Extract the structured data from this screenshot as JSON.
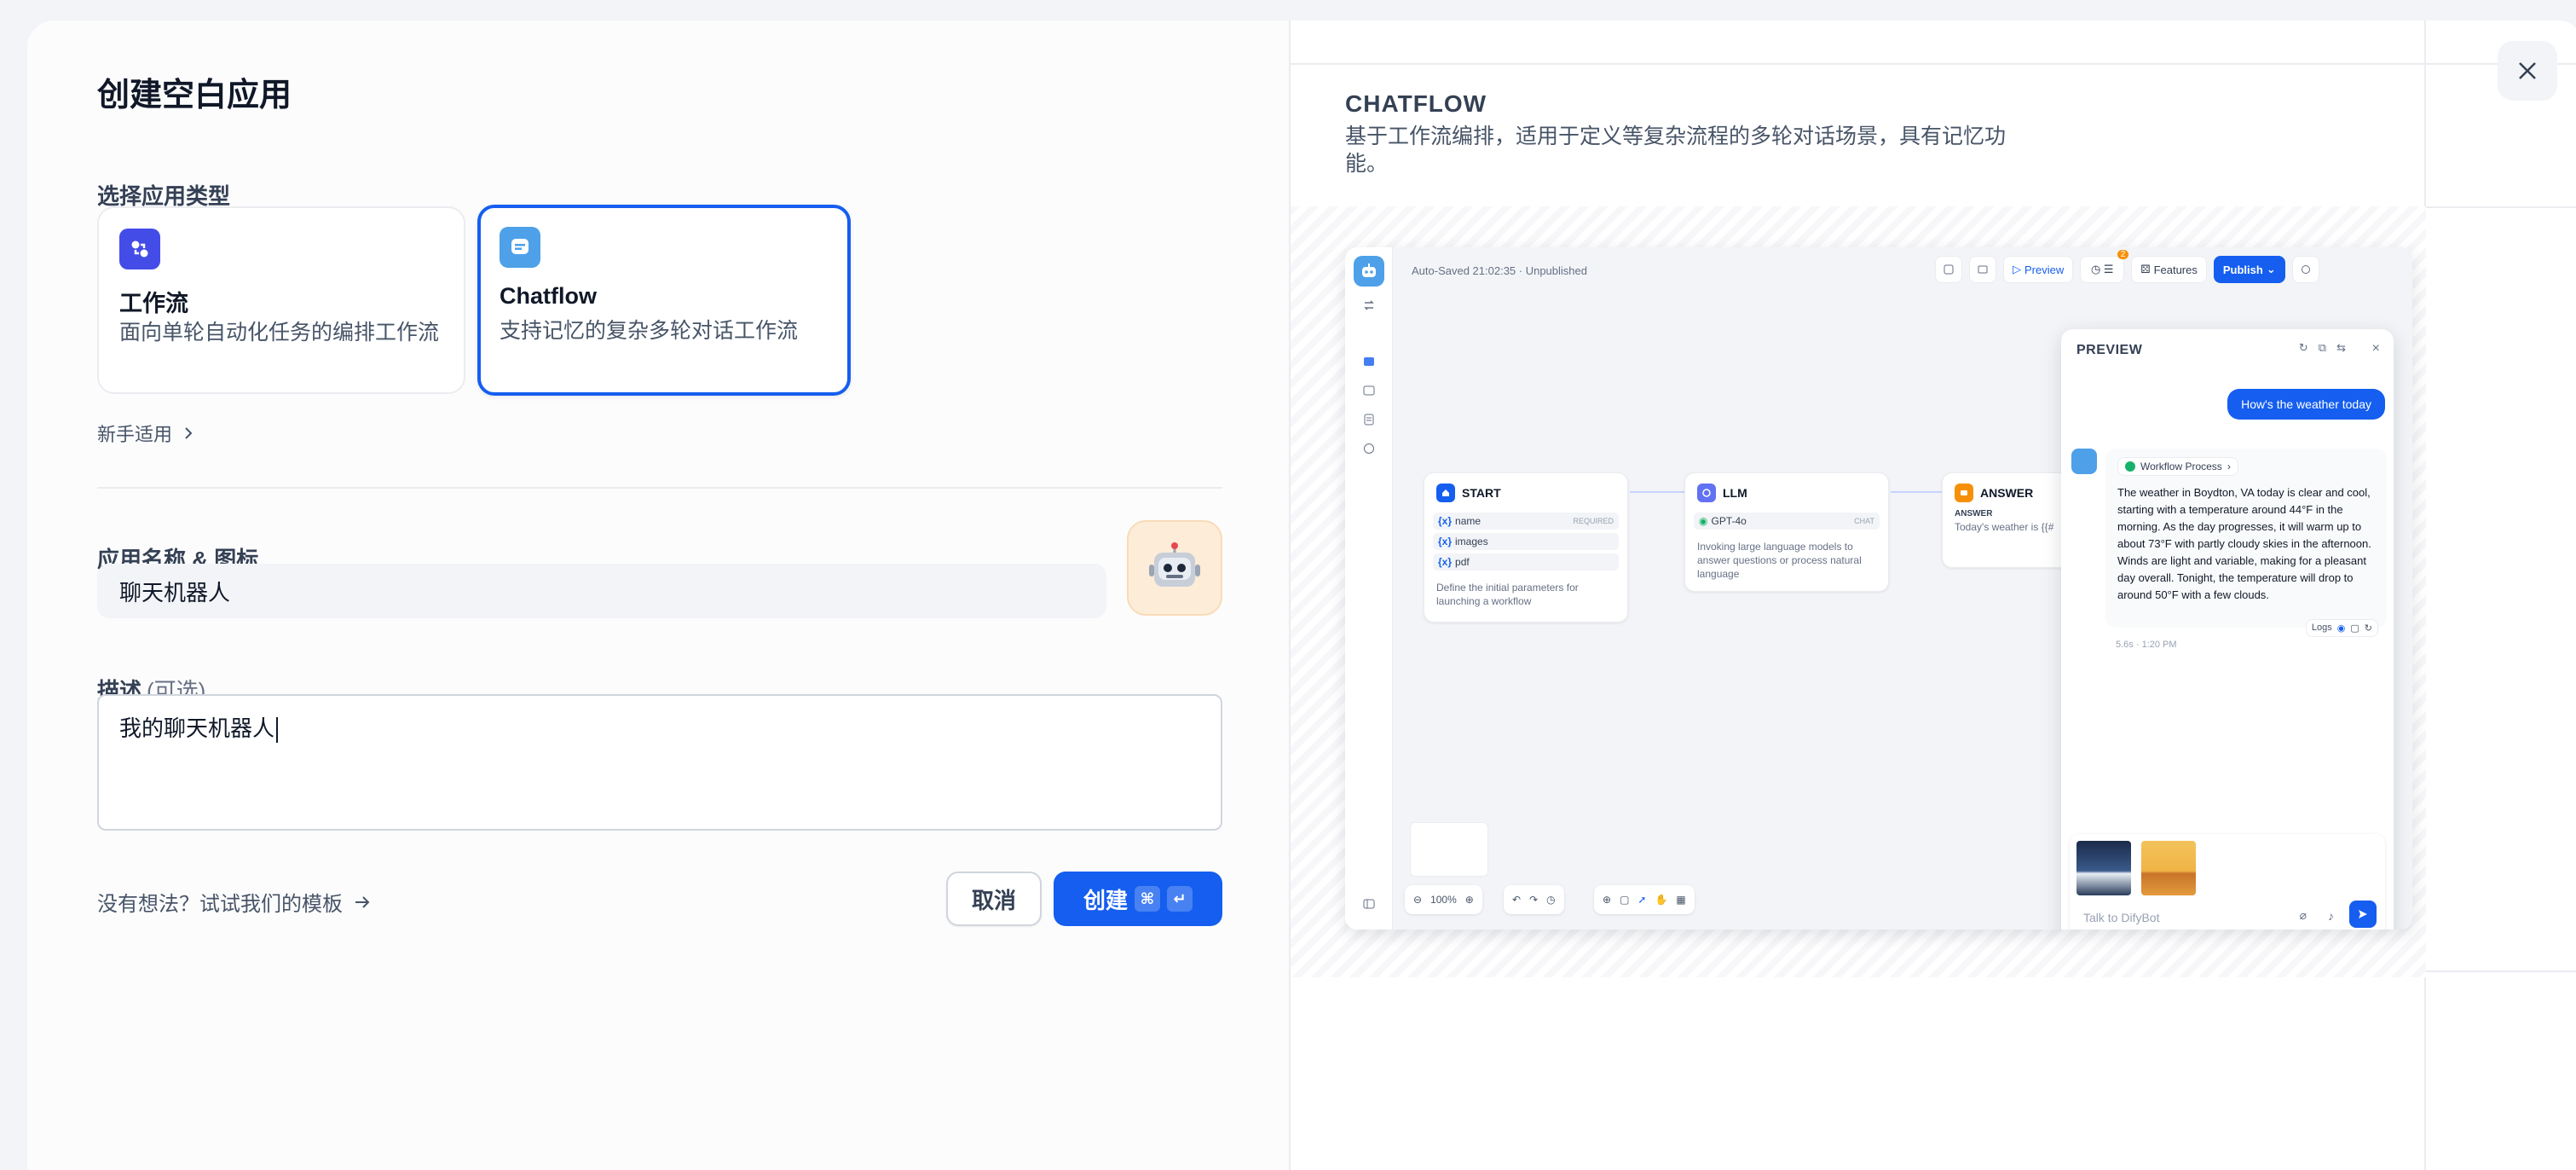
{
  "dialog": {
    "title": "创建空白应用",
    "type_section_label": "选择应用类型",
    "app_types": [
      {
        "name": "工作流",
        "desc": "面向单轮自动化任务的编排工作流",
        "selected": false,
        "icon": "workflow-icon",
        "color": "#444ce7"
      },
      {
        "name": "Chatflow",
        "desc": "支持记忆的复杂多轮对话工作流",
        "selected": true,
        "icon": "chatflow-icon",
        "color": "#4ea0e8"
      }
    ],
    "beginner_link": "新手适用",
    "name_section_label": "应用名称 & 图标",
    "name_value": "聊天机器人",
    "avatar_emoji": "🤖",
    "desc_section_label": "描述",
    "desc_optional": "(可选)",
    "desc_value": "我的聊天机器人",
    "template_link": "没有想法？试试我们的模板",
    "cancel_label": "取消",
    "create_label": "创建",
    "create_shortcut": [
      "⌘",
      "↵"
    ],
    "accent_color": "#155eef"
  },
  "preview_panel": {
    "title": "CHATFLOW",
    "description": "基于工作流编排，适用于定义等复杂流程的多轮对话场景，具有记忆功能。",
    "app": {
      "autosave_text": "Auto-Saved 21:02:35 · Unpublished",
      "toolbar": {
        "preview": "Preview",
        "features": "Features",
        "publish": "Publish",
        "badge": "2"
      },
      "nodes": {
        "start": {
          "title": "START",
          "vars": [
            {
              "name": "name",
              "tag": "REQUIRED"
            },
            {
              "name": "images",
              "tag": ""
            },
            {
              "name": "pdf",
              "tag": ""
            }
          ],
          "note": "Define the initial parameters for launching a workflow"
        },
        "llm": {
          "title": "LLM",
          "model": "GPT-4o",
          "tag": "CHAT",
          "note": "Invoking large language models to answer questions or process natural language"
        },
        "answer": {
          "title": "ANSWER",
          "label": "ANSWER",
          "note": "Today's weather is {{#"
        }
      },
      "zoom": "100%",
      "chat": {
        "title": "PREVIEW",
        "user_message": "How's the weather today",
        "workflow_chip": "Workflow Process",
        "bot_message": "The weather in Boydton, VA today is clear and cool, starting with a temperature around 44°F in the morning. As the day progresses, it will warm up to about 73°F with partly cloudy skies in the afternoon. Winds are light and variable, making for a pleasant day overall. Tonight, the temperature will drop to around 50°F with a few clouds.",
        "meta": "5.6s · 1:20 PM",
        "logs_label": "Logs",
        "input_placeholder": "Talk to DifyBot"
      }
    }
  }
}
